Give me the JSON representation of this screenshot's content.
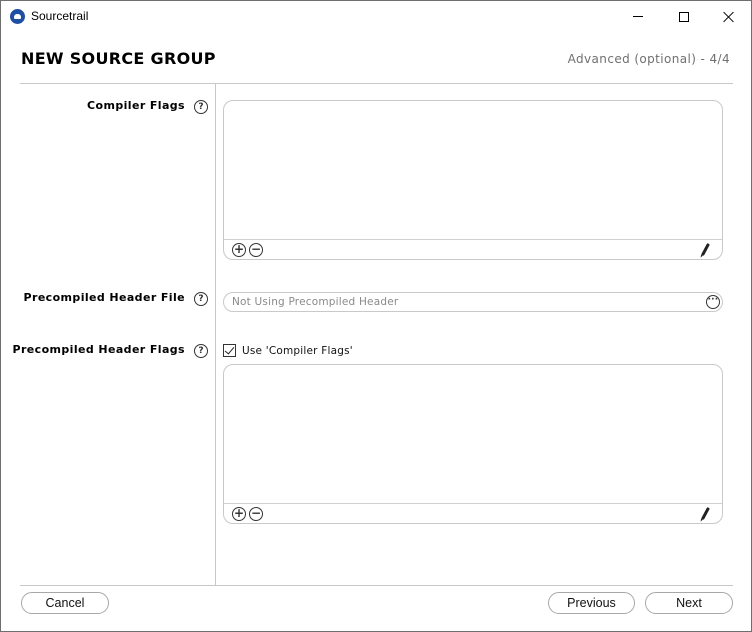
{
  "window": {
    "title": "Sourcetrail"
  },
  "header": {
    "title": "NEW SOURCE GROUP",
    "step": "Advanced (optional) - 4/4"
  },
  "fields": {
    "compiler_flags": {
      "label": "Compiler Flags",
      "help": "?",
      "items": []
    },
    "precompiled_header_file": {
      "label": "Precompiled Header File",
      "help": "?",
      "placeholder": "Not Using Precompiled Header",
      "browse_glyph": "···"
    },
    "precompiled_header_flags": {
      "label": "Precompiled Header Flags",
      "help": "?",
      "checkbox_label": "Use 'Compiler Flags'",
      "checked": true,
      "items": []
    }
  },
  "list_controls": {
    "add": "+",
    "remove": "−"
  },
  "footer": {
    "cancel": "Cancel",
    "previous": "Previous",
    "next": "Next"
  }
}
